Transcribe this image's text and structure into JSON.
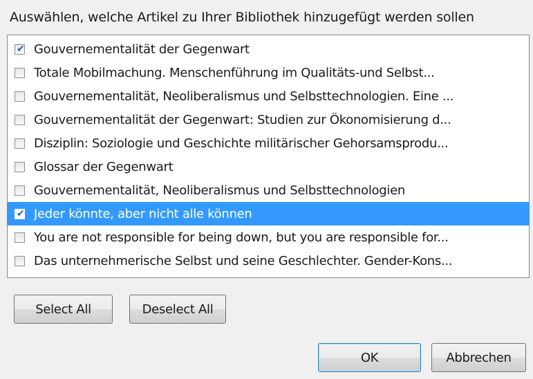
{
  "dialog": {
    "prompt": "Auswählen, welche Artikel zu Ihrer Bibliothek hinzugefügt werden sollen"
  },
  "items": [
    {
      "label": "Gouvernementalität der Gegenwart",
      "checked": true,
      "selected": false
    },
    {
      "label": "Totale Mobilmachung. Menschenführung im Qualitäts-und Selbst...",
      "checked": false,
      "selected": false
    },
    {
      "label": "Gouvernementalität, Neoliberalismus und Selbsttechnologien. Eine ...",
      "checked": false,
      "selected": false
    },
    {
      "label": "Gouvernementalität der Gegenwart: Studien zur Ökonomisierung d...",
      "checked": false,
      "selected": false
    },
    {
      "label": "Disziplin: Soziologie und Geschichte militärischer Gehorsamsprodu...",
      "checked": false,
      "selected": false
    },
    {
      "label": "Glossar der Gegenwart",
      "checked": false,
      "selected": false
    },
    {
      "label": "Gouvernementalität, Neoliberalismus und Selbsttechnologien",
      "checked": false,
      "selected": false
    },
    {
      "label": "Jeder könnte, aber nicht alle können",
      "checked": true,
      "selected": true
    },
    {
      "label": "You are not responsible for being down, but you are responsible for...",
      "checked": false,
      "selected": false
    },
    {
      "label": "Das unternehmerische Selbst und seine Geschlechter. Gender-Kons...",
      "checked": false,
      "selected": false
    }
  ],
  "buttons": {
    "select_all": "Select All",
    "deselect_all": "Deselect All",
    "ok": "OK",
    "cancel": "Abbrechen"
  },
  "colors": {
    "selection": "#3399ff",
    "background": "#f0f0f0"
  }
}
